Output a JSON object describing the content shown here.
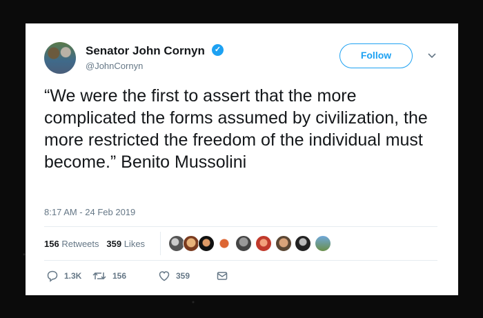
{
  "tweet": {
    "name": "Senator John Cornyn",
    "handle": "@JohnCornyn",
    "follow_label": "Follow",
    "text": "“We were the first to assert that the more complicated the forms assumed by civilization, the more restricted the freedom of the individual must become.” Benito Mussolini",
    "timestamp": "8:17 AM - 24 Feb 2019",
    "retweets_count": "156",
    "retweets_label": "Retweets",
    "likes_count": "359",
    "likes_label": "Likes",
    "actions": {
      "reply_count": "1.3K",
      "retweet_count": "156",
      "like_count": "359"
    },
    "verified_color": "#1da1f2",
    "accent_color": "#1da1f2"
  }
}
